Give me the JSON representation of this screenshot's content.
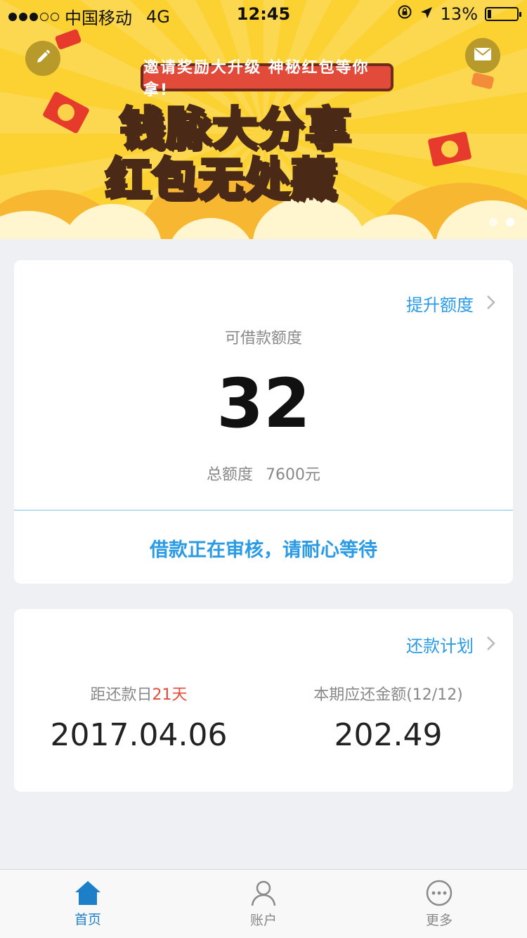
{
  "status_bar": {
    "carrier": "中国移动",
    "network": "4G",
    "time": "12:45",
    "battery": "13%",
    "battery_level": 0.13
  },
  "banner": {
    "ribbon_text": "邀请奖励大升级  神秘红包等你拿!",
    "headline_line1_a": "钱脉",
    "headline_line1_b": "大分享",
    "headline_line2_a": "红包",
    "headline_line2_b": "无处藏",
    "pager_count": 2,
    "pager_active": 1
  },
  "credit": {
    "raise_limit_link": "提升额度",
    "available_label": "可借款额度",
    "available_value": "32",
    "total_label": "总额度",
    "total_value": "7600元",
    "review_status": "借款正在审核，请耐心等待"
  },
  "repayment": {
    "plan_link": "还款计划",
    "due_label": "距还款日",
    "due_days": "21天",
    "due_date": "2017.04.06",
    "amount_label": "本期应还金额(12/12)",
    "amount_value": "202.49"
  },
  "tabs": [
    {
      "label": "首页",
      "icon": "home-icon",
      "active": true
    },
    {
      "label": "账户",
      "icon": "user-icon",
      "active": false
    },
    {
      "label": "更多",
      "icon": "more-icon",
      "active": false
    }
  ],
  "colors": {
    "accent_blue": "#2a9be4",
    "tab_active": "#1e7fc9",
    "banner_yellow": "#fcd233",
    "highlight_red": "#e34b3a"
  }
}
